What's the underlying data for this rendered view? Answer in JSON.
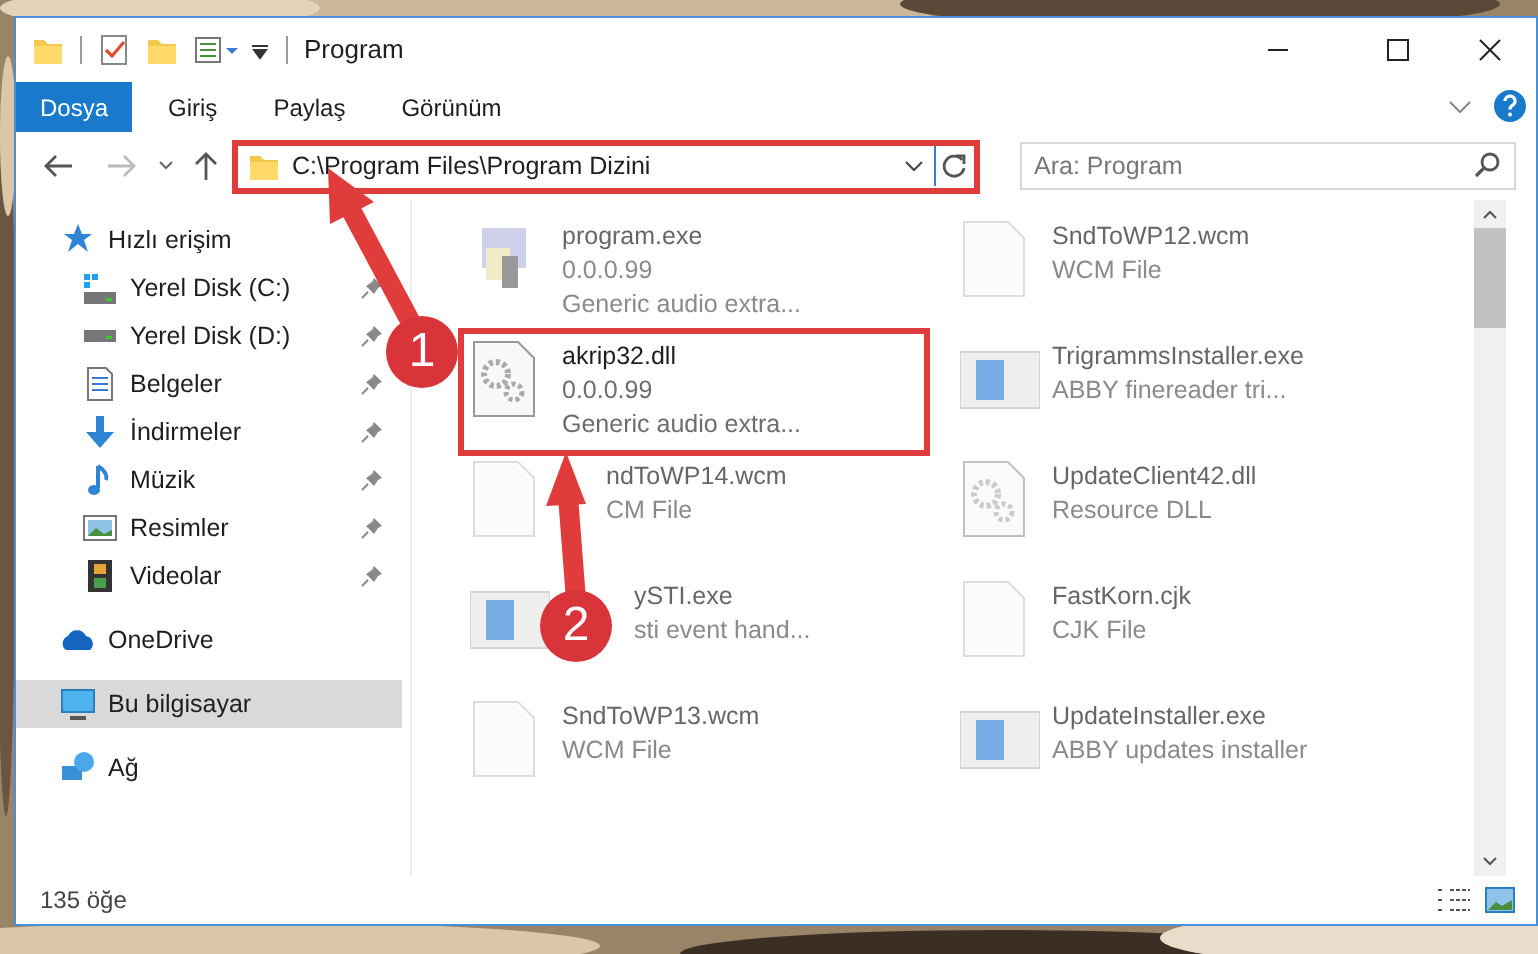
{
  "window": {
    "title": "Program"
  },
  "ribbon_tabs": [
    {
      "label": "Dosya",
      "selected": true
    },
    {
      "label": "Giriş",
      "selected": false
    },
    {
      "label": "Paylaş",
      "selected": false
    },
    {
      "label": "Görünüm",
      "selected": false
    }
  ],
  "address_bar": {
    "value": "C:\\Program Files\\Program Dizini",
    "highlighted": true
  },
  "search": {
    "placeholder": "Ara: Program"
  },
  "navigation": [
    {
      "label": "Hızlı erişim",
      "selected": false,
      "children": [
        {
          "label": "Yerel Disk (C:)",
          "pinned": true,
          "selected": false
        },
        {
          "label": "Yerel Disk (D:)",
          "pinned": true,
          "selected": false
        },
        {
          "label": "Belgeler",
          "pinned": true,
          "selected": false
        },
        {
          "label": "İndirmeler",
          "pinned": true,
          "selected": false
        },
        {
          "label": "Müzik",
          "pinned": true,
          "selected": false
        },
        {
          "label": "Resimler",
          "pinned": true,
          "selected": false
        },
        {
          "label": "Videolar",
          "pinned": true,
          "selected": false
        }
      ]
    },
    {
      "label": "OneDrive",
      "selected": false
    },
    {
      "label": "Bu bilgisayar",
      "selected": true
    },
    {
      "label": "Ağ",
      "selected": false
    }
  ],
  "files": [
    {
      "name": "program.exe",
      "details": [
        "0.0.0.99",
        "Generic audio extra..."
      ],
      "kind": "app",
      "faded": true,
      "highlighted": false
    },
    {
      "name": "SndToWP12.wcm",
      "details": [
        "WCM File"
      ],
      "kind": "blank",
      "faded": true,
      "highlighted": false
    },
    {
      "name": "akrip32.dll",
      "details": [
        "0.0.0.99",
        "Generic audio extra..."
      ],
      "kind": "gear",
      "faded": false,
      "highlighted": true
    },
    {
      "name": "TrigrammsInstaller.exe",
      "details": [
        "ABBY finereader tri..."
      ],
      "kind": "window",
      "faded": true,
      "highlighted": false
    },
    {
      "name": "ndToWP14.wcm",
      "details": [
        "CM File"
      ],
      "kind": "blank",
      "faded": true,
      "highlighted": false
    },
    {
      "name": "UpdateClient42.dll",
      "details": [
        "Resource DLL"
      ],
      "kind": "gear",
      "faded": true,
      "highlighted": false
    },
    {
      "name": "ySTI.exe",
      "details": [
        "sti event hand..."
      ],
      "kind": "window",
      "faded": true,
      "highlighted": false
    },
    {
      "name": "FastKorn.cjk",
      "details": [
        "CJK File"
      ],
      "kind": "blank",
      "faded": true,
      "highlighted": false
    },
    {
      "name": "SndToWP13.wcm",
      "details": [
        "WCM File"
      ],
      "kind": "blank",
      "faded": true,
      "highlighted": false
    },
    {
      "name": "UpdateInstaller.exe",
      "details": [
        "ABBY updates installer"
      ],
      "kind": "window",
      "faded": true,
      "highlighted": false
    }
  ],
  "status_bar": {
    "item_count": "135 öğe"
  },
  "callouts": [
    {
      "number": "1"
    },
    {
      "number": "2"
    }
  ]
}
